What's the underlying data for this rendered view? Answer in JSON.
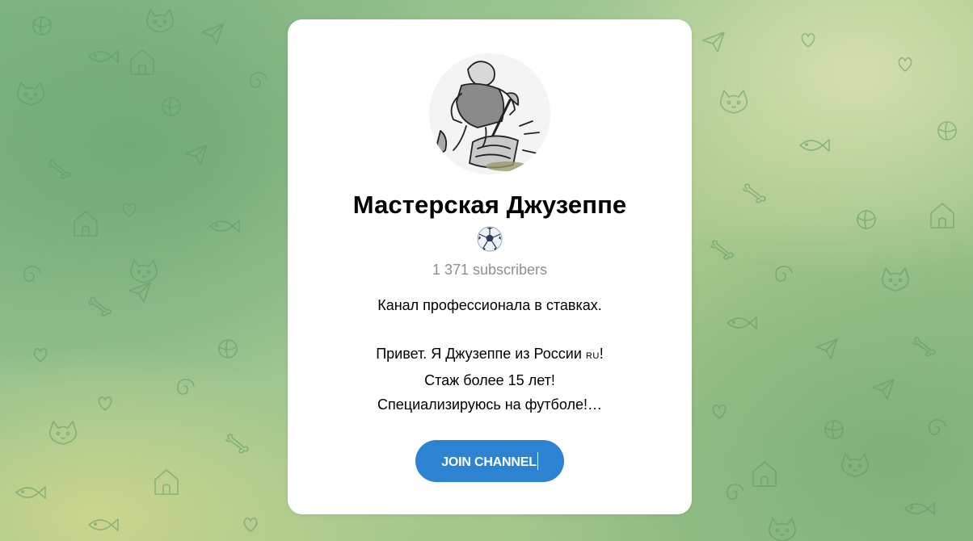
{
  "channel": {
    "title": "Мастерская Джузеппе",
    "title_emoji": "⚽",
    "subscribers": "1 371 subscribers",
    "description": {
      "line1": "Канал профессионала в ставках.",
      "line2": "Привет. Я Джузеппе из России ",
      "line2_flag": "RU",
      "line2_end": "!",
      "line3": "Стаж более 15 лет!",
      "line4": "Специализируюсь на футболе!…"
    }
  },
  "actions": {
    "join_label": "JOIN CHANNEL"
  },
  "colors": {
    "accent": "#2c83d1",
    "subtitle": "#8f8f8f",
    "card_bg": "#ffffff"
  },
  "icons": {
    "avatar": "channel-avatar-illustration",
    "emoji": "soccer-ball-icon",
    "background": "doodle-pattern"
  }
}
